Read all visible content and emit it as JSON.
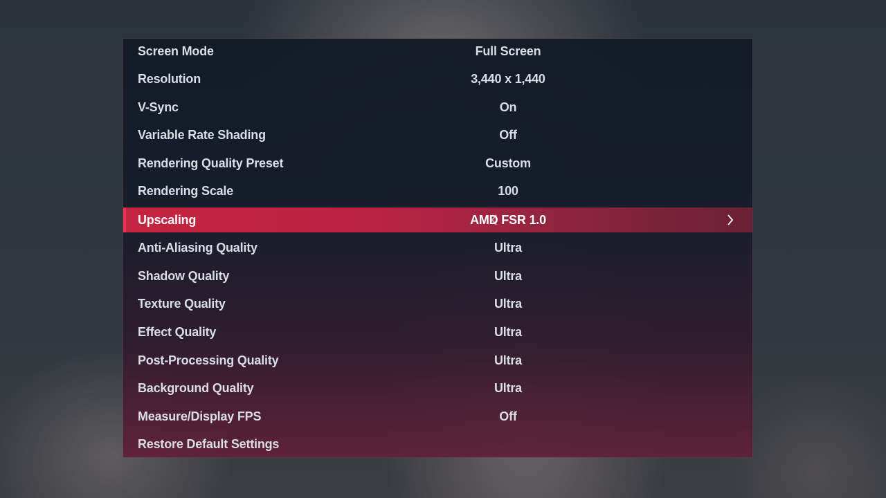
{
  "settings": {
    "rows": [
      {
        "label": "Screen Mode",
        "value": "Full Screen"
      },
      {
        "label": "Resolution",
        "value": "3,440 x 1,440"
      },
      {
        "label": "V-Sync",
        "value": "On"
      },
      {
        "label": "Variable Rate Shading",
        "value": "Off"
      },
      {
        "label": "Rendering Quality Preset",
        "value": "Custom"
      },
      {
        "label": "Rendering Scale",
        "value": "100"
      },
      {
        "label": "Upscaling",
        "value": "AMD FSR 1.0",
        "selected": true
      },
      {
        "label": "Anti-Aliasing Quality",
        "value": "Ultra"
      },
      {
        "label": "Shadow Quality",
        "value": "Ultra"
      },
      {
        "label": "Texture Quality",
        "value": "Ultra"
      },
      {
        "label": "Effect Quality",
        "value": "Ultra"
      },
      {
        "label": "Post-Processing Quality",
        "value": "Ultra"
      },
      {
        "label": "Background Quality",
        "value": "Ultra"
      },
      {
        "label": "Measure/Display FPS",
        "value": "Off"
      },
      {
        "label": "Restore Default Settings",
        "value": ""
      }
    ],
    "icons": {
      "prev": "chevron-left-icon",
      "next": "chevron-right-icon"
    },
    "colors": {
      "accent": "#c42440",
      "text": "#d9dde4"
    }
  }
}
